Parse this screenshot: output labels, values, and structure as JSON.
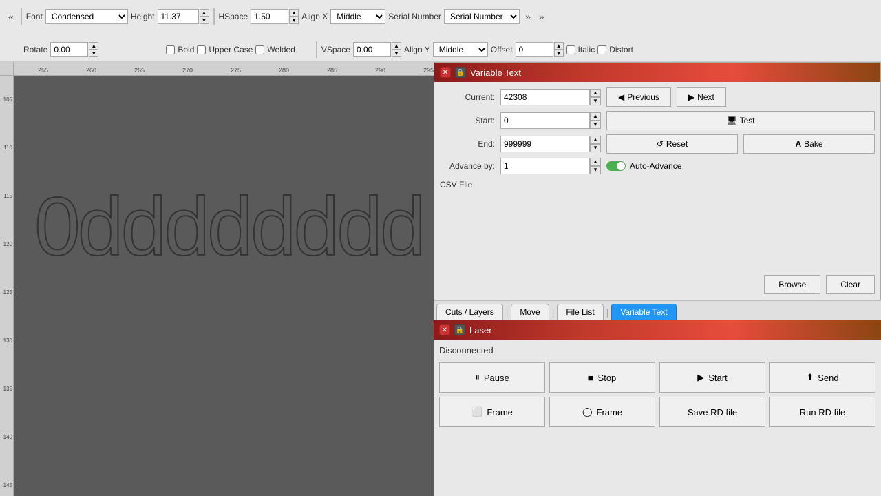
{
  "toolbar": {
    "collapse_left_label": "«",
    "font_label": "Font",
    "font_value": "Condensed",
    "height_label": "Height",
    "height_value": "11.37",
    "hspace_label": "HSpace",
    "hspace_value": "1.50",
    "alignx_label": "Align X",
    "alignx_value": "Middle",
    "serial_number_label": "Serial Number",
    "vspace_label": "VSpace",
    "vspace_value": "0.00",
    "aligny_label": "Align Y",
    "aligny_value": "Middle",
    "offset_label": "Offset",
    "offset_value": "0",
    "rotate_label": "Rotate",
    "rotate_value": "0.00",
    "bold_label": "Bold",
    "uppercase_label": "Upper Case",
    "welded_label": "Welded",
    "italic_label": "Italic",
    "distort_label": "Distort",
    "collapse_right_label": "»",
    "collapse_right2_label": "»"
  },
  "canvas": {
    "text_content": "0dddddddd",
    "ruler_numbers_top": [
      "255",
      "260",
      "265",
      "270",
      "275",
      "280",
      "285",
      "290",
      "295"
    ],
    "ruler_numbers_left": [
      "105",
      "110",
      "115",
      "120",
      "125",
      "130",
      "135",
      "140",
      "145"
    ]
  },
  "variable_text_panel": {
    "title": "Variable Text",
    "current_label": "Current:",
    "current_value": "42308",
    "start_label": "Start:",
    "start_value": "0",
    "end_label": "End:",
    "end_value": "999999",
    "advance_by_label": "Advance by:",
    "advance_by_value": "1",
    "previous_label": "Previous",
    "next_label": "Next",
    "test_label": "Test",
    "reset_label": "Reset",
    "bake_label": "Bake",
    "auto_advance_label": "Auto-Advance",
    "csv_file_label": "CSV File",
    "browse_label": "Browse",
    "clear_label": "Clear"
  },
  "tabs": {
    "items": [
      {
        "label": "Cuts / Layers",
        "active": false
      },
      {
        "label": "Move",
        "active": false
      },
      {
        "label": "File List",
        "active": false
      },
      {
        "label": "Variable Text",
        "active": true
      }
    ]
  },
  "laser_panel": {
    "title": "Laser",
    "status": "Disconnected",
    "pause_label": "Pause",
    "stop_label": "Stop",
    "start_label": "Start",
    "send_label": "Send",
    "frame1_label": "Frame",
    "frame2_label": "Frame",
    "save_rd_label": "Save RD file",
    "run_rd_label": "Run RD file"
  },
  "icons": {
    "close": "✕",
    "pin": "📌",
    "previous_arrow": "◀",
    "next_arrow": "▶",
    "test_icon": "🖥",
    "reset_icon": "↺",
    "bake_icon": "A",
    "pause_icon": "⏸",
    "stop_icon": "■",
    "start_icon": "▶",
    "send_icon": "⬆",
    "frame1_icon": "⬜",
    "frame2_icon": "◯",
    "up_arrow": "▲",
    "down_arrow": "▼"
  }
}
